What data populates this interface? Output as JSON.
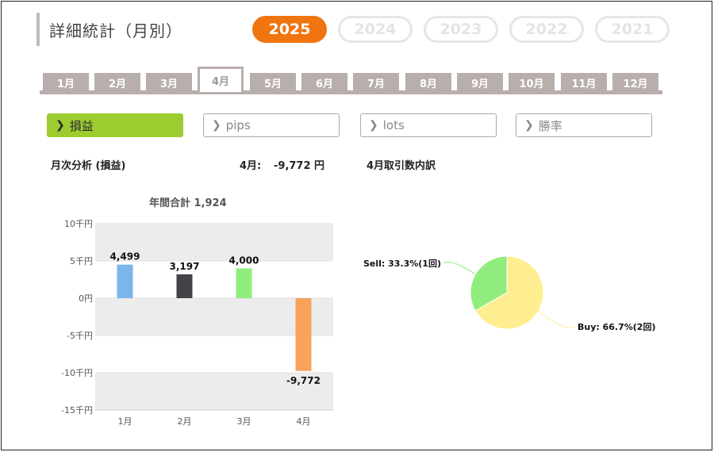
{
  "page": {
    "title": "詳細統計（月別）"
  },
  "years": [
    {
      "label": "2025",
      "active": true
    },
    {
      "label": "2024",
      "active": false
    },
    {
      "label": "2023",
      "active": false
    },
    {
      "label": "2022",
      "active": false
    },
    {
      "label": "2021",
      "active": false
    }
  ],
  "months": [
    {
      "label": "1月",
      "active": false
    },
    {
      "label": "2月",
      "active": false
    },
    {
      "label": "3月",
      "active": false
    },
    {
      "label": "4月",
      "active": true
    },
    {
      "label": "5月",
      "active": false
    },
    {
      "label": "6月",
      "active": false
    },
    {
      "label": "7月",
      "active": false
    },
    {
      "label": "8月",
      "active": false
    },
    {
      "label": "9月",
      "active": false
    },
    {
      "label": "10月",
      "active": false
    },
    {
      "label": "11月",
      "active": false
    },
    {
      "label": "12月",
      "active": false
    }
  ],
  "categories": [
    {
      "label": "損益",
      "active": true
    },
    {
      "label": "pips",
      "active": false
    },
    {
      "label": "lots",
      "active": false
    },
    {
      "label": "勝率",
      "active": false
    }
  ],
  "analysis": {
    "section_title": "月次分析 (損益)",
    "month_label": "4月:",
    "month_value": "-9,772 円",
    "breakdown_title": "4月取引数内訳"
  },
  "colors": {
    "accent_orange": "#f0740f",
    "accent_green": "#9ccc30",
    "tab_gray": "#b8aeac"
  },
  "chart_data": [
    {
      "type": "bar",
      "title": "年間合計 1,924",
      "categories": [
        "1月",
        "2月",
        "3月",
        "4月"
      ],
      "values": [
        4499,
        3197,
        4000,
        -9772
      ],
      "data_labels": [
        "4,499",
        "3,197",
        "4,000",
        "-9,772"
      ],
      "bar_colors": [
        "#7cb5ec",
        "#434348",
        "#90ed7d",
        "#f7a35c"
      ],
      "ylim": [
        -15000,
        10000
      ],
      "y_ticks": [
        10000,
        5000,
        0,
        -5000,
        -10000,
        -15000
      ],
      "y_tick_labels": [
        "10千円",
        "5千円",
        "0円",
        "-5千円",
        "-10千円",
        "-15千円"
      ],
      "grid": true
    },
    {
      "type": "pie",
      "slices": [
        {
          "label": "Sell",
          "value": 33.3,
          "count": 1,
          "text": "Sell: 33.3%(1回)",
          "color": "#90ed7d"
        },
        {
          "label": "Buy",
          "value": 66.7,
          "count": 2,
          "text": "Buy: 66.7%(2回)",
          "color": "#ffee8f"
        }
      ]
    }
  ]
}
